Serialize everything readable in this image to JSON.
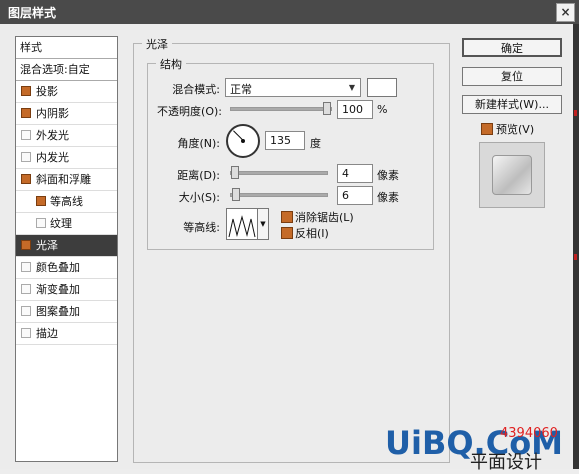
{
  "window": {
    "title": "图层样式",
    "close": "×"
  },
  "style_list": {
    "header": "样式",
    "blend_options": "混合选项:自定",
    "items": [
      {
        "label": "投影",
        "checked": true
      },
      {
        "label": "内阴影",
        "checked": true
      },
      {
        "label": "外发光",
        "checked": false
      },
      {
        "label": "内发光",
        "checked": false
      },
      {
        "label": "斜面和浮雕",
        "checked": true
      },
      {
        "label": "等高线",
        "checked": true
      },
      {
        "label": "纹理",
        "checked": false
      },
      {
        "label": "光泽",
        "checked": true
      },
      {
        "label": "颜色叠加",
        "checked": false
      },
      {
        "label": "渐变叠加",
        "checked": false
      },
      {
        "label": "图案叠加",
        "checked": false
      },
      {
        "label": "描边",
        "checked": false
      }
    ]
  },
  "gloss": {
    "title": "光泽",
    "structure_title": "结构",
    "blend_mode_label": "混合模式:",
    "blend_mode_value": "正常",
    "opacity_label": "不透明度(O):",
    "opacity_value": "100",
    "opacity_unit": "%",
    "angle_label": "角度(N):",
    "angle_value": "135",
    "angle_unit": "度",
    "distance_label": "距离(D):",
    "distance_value": "4",
    "distance_unit": "像素",
    "size_label": "大小(S):",
    "size_value": "6",
    "size_unit": "像素",
    "contour_label": "等高线:",
    "anti_alias_label": "消除锯齿(L)",
    "anti_alias_checked": true,
    "invert_label": "反相(I)",
    "invert_checked": true
  },
  "buttons": {
    "ok": "确定",
    "reset": "复位",
    "new_style": "新建样式(W)...",
    "preview_label": "预览(V)",
    "preview_checked": true
  },
  "watermark": {
    "site": "UiBQ.CoM",
    "number": "4394060",
    "caption": "平面设计"
  },
  "colors": {
    "checkbox_on": "#c46a28",
    "selected_row": "#3d3d3d",
    "titlebar": "#4a4a4a",
    "watermark_blue": "#1f5fa8",
    "watermark_red": "#e02020"
  }
}
